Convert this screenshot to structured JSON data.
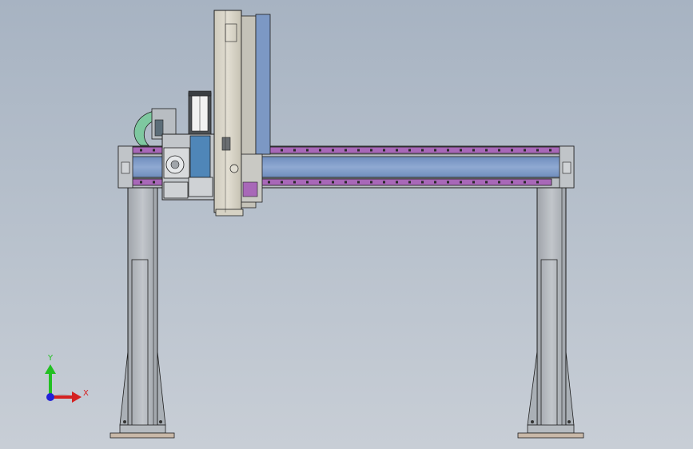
{
  "viewport": {
    "background_top": "#a7b3c2",
    "background_bottom": "#c8ced6"
  },
  "triad": {
    "y_label": "Y",
    "x_label": "X",
    "y_color": "#22c022",
    "x_color": "#d42222",
    "z_color": "#2222d8",
    "icon": "axis-triad-icon"
  },
  "model": {
    "frame_color": "#b9bec3",
    "edge_color": "#1e1e1e",
    "beam_rail_color": "#a868b8",
    "beam_core_color": "#7c98c4",
    "motor_color": "#4f86b8",
    "cable_color": "#7ec8a0",
    "column_color": "#d6d2c4"
  }
}
